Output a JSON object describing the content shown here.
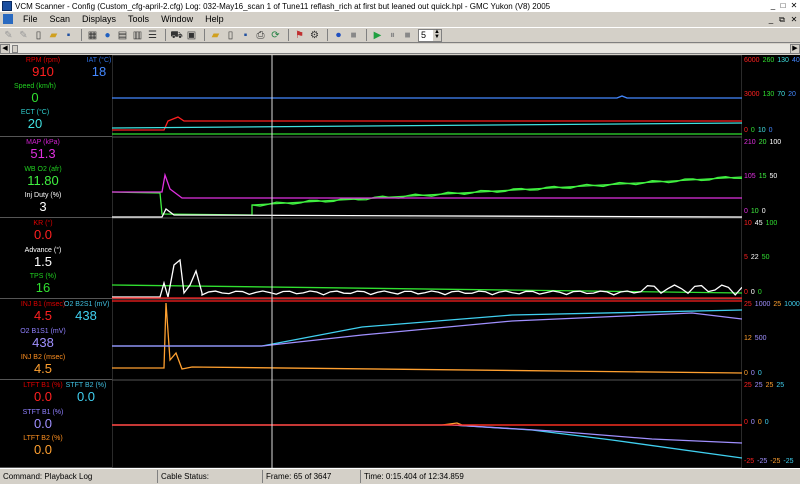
{
  "window": {
    "title": "VCM Scanner - Config (Custom_cfg-april-2.cfg)    Log: 032-May16_scan 1 of Tune11 reflash_rich at first but leaned out quick.hpl  -  GMC Yukon (V8) 2005"
  },
  "menu": [
    "File",
    "Scan",
    "Displays",
    "Tools",
    "Window",
    "Help"
  ],
  "toolbar": {
    "spin_value": "5"
  },
  "panels": [
    {
      "channels": [
        {
          "name": "RPM (rpm)",
          "value": "910",
          "name_color": "#e00000",
          "value_color": "#ff2020"
        },
        {
          "name": "IAT (°C)",
          "value": "18",
          "name_color": "#3070e0",
          "value_color": "#4488ff"
        },
        {
          "name": "Speed (km/h)",
          "value": "0",
          "name_color": "#20d020",
          "value_color": "#30e030"
        },
        {
          "name": "ECT (°C)",
          "value": "20",
          "name_color": "#30d0d0",
          "value_color": "#40e0e0"
        }
      ],
      "scales": [
        {
          "labels": [
            "6000",
            "260",
            "130",
            "40"
          ],
          "colors": [
            "#ff2020",
            "#30e030",
            "#40e0e0",
            "#4488ff"
          ]
        },
        {
          "labels": [
            "3000",
            "130",
            "70",
            "20"
          ],
          "colors": [
            "#ff2020",
            "#30e030",
            "#40e0e0",
            "#4488ff"
          ]
        },
        {
          "labels": [
            "0",
            "0",
            "10",
            "0"
          ],
          "colors": [
            "#ff2020",
            "#30e030",
            "#40e0e0",
            "#4488ff"
          ]
        }
      ]
    },
    {
      "channels": [
        {
          "name": "MAP (kPa)",
          "value": "51.3",
          "name_color": "#d020d0",
          "value_color": "#e030e0"
        },
        {
          "name": "WB O2 (afr)",
          "value": "11.80",
          "name_color": "#20d020",
          "value_color": "#40f040"
        },
        {
          "name": "Inj Duty (%)",
          "value": "3",
          "name_color": "#ffffff",
          "value_color": "#ffffff"
        }
      ],
      "scales": [
        {
          "labels": [
            "210",
            "20",
            "100"
          ],
          "colors": [
            "#e030e0",
            "#40f040",
            "#ffffff"
          ]
        },
        {
          "labels": [
            "105",
            "15",
            "50"
          ],
          "colors": [
            "#e030e0",
            "#40f040",
            "#ffffff"
          ]
        },
        {
          "labels": [
            "0",
            "10",
            "0"
          ],
          "colors": [
            "#e030e0",
            "#40f040",
            "#ffffff"
          ]
        }
      ]
    },
    {
      "channels": [
        {
          "name": "KR (°)",
          "value": "0.0",
          "name_color": "#e00000",
          "value_color": "#ff2020"
        },
        {
          "name": "Advance (°)",
          "value": "1.5",
          "name_color": "#ffffff",
          "value_color": "#ffffff"
        },
        {
          "name": "TPS (%)",
          "value": "16",
          "name_color": "#20d020",
          "value_color": "#30e030"
        }
      ],
      "scales": [
        {
          "labels": [
            "10",
            "45",
            "100"
          ],
          "colors": [
            "#ff2020",
            "#ffffff",
            "#30e030"
          ]
        },
        {
          "labels": [
            "5",
            "22",
            "50"
          ],
          "colors": [
            "#ff2020",
            "#ffffff",
            "#30e030"
          ]
        },
        {
          "labels": [
            "0",
            "0",
            "0"
          ],
          "colors": [
            "#ff2020",
            "#ffffff",
            "#30e030"
          ]
        }
      ]
    },
    {
      "channels": [
        {
          "name": "INJ B1 (msec)",
          "value": "4.5",
          "name_color": "#e00000",
          "value_color": "#ff2020"
        },
        {
          "name": "O2 B2S1 (mV)",
          "value": "438",
          "name_color": "#40c0e0",
          "value_color": "#40d0f0"
        },
        {
          "name": "O2 B1S1 (mV)",
          "value": "438",
          "name_color": "#9080ff",
          "value_color": "#a090ff"
        },
        {
          "name": "INJ B2 (msec)",
          "value": "4.5",
          "name_color": "#ff9020",
          "value_color": "#ffa030"
        }
      ],
      "scales": [
        {
          "labels": [
            "25",
            "1000",
            "25",
            "1000"
          ],
          "colors": [
            "#ff2020",
            "#a090ff",
            "#ffa030",
            "#40d0f0"
          ]
        },
        {
          "labels": [
            "12",
            "500"
          ],
          "colors": [
            "#ffa030",
            "#a090ff"
          ]
        },
        {
          "labels": [
            "0",
            "0",
            "0"
          ],
          "colors": [
            "#ffa030",
            "#a090ff",
            "#40d0f0"
          ]
        }
      ]
    },
    {
      "channels": [
        {
          "name": "LTFT B1 (%)",
          "value": "0.0",
          "name_color": "#e00000",
          "value_color": "#ff2020"
        },
        {
          "name": "STFT B2 (%)",
          "value": "0.0",
          "name_color": "#40c0e0",
          "value_color": "#40d0f0"
        },
        {
          "name": "STFT B1 (%)",
          "value": "0.0",
          "name_color": "#9080ff",
          "value_color": "#a090ff"
        },
        {
          "name": "LTFT B2 (%)",
          "value": "0.0",
          "name_color": "#ff9020",
          "value_color": "#ffa030"
        }
      ],
      "scales": [
        {
          "labels": [
            "25",
            "25",
            "25",
            "25"
          ],
          "colors": [
            "#ff2020",
            "#a090ff",
            "#ffa030",
            "#40d0f0"
          ]
        },
        {
          "labels": [
            "0",
            "0",
            "0",
            "0"
          ],
          "colors": [
            "#ff2020",
            "#a090ff",
            "#ffa030",
            "#40d0f0"
          ]
        },
        {
          "labels": [
            "-25",
            "-25",
            "-25",
            "-25"
          ],
          "colors": [
            "#ff2020",
            "#a090ff",
            "#ffa030",
            "#40d0f0"
          ]
        }
      ]
    }
  ],
  "status": {
    "command": "Command:  Playback Log",
    "cable": "Cable Status:",
    "frame": "Frame:  65 of 3647",
    "time": "Time:  0:15.404 of 12:34.859"
  }
}
